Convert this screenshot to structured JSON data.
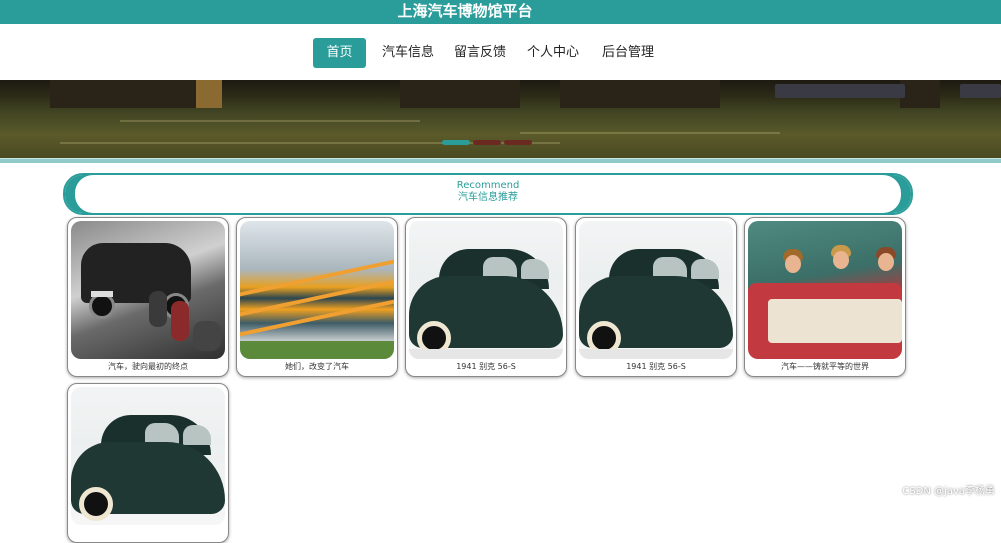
{
  "header": {
    "title": "上海汽车博物馆平台"
  },
  "nav": [
    {
      "label": "首页",
      "active": true
    },
    {
      "label": "汽车信息",
      "active": false
    },
    {
      "label": "留言反馈",
      "active": false
    },
    {
      "label": "个人中心",
      "active": false
    },
    {
      "label": "后台管理",
      "active": false
    }
  ],
  "carousel": {
    "slide_count": 3,
    "active_slide": 1
  },
  "recommend": {
    "en": "Recommend",
    "cn": "汽车信息推荐"
  },
  "cards": [
    {
      "caption": "汽车，驶向最初的终点",
      "image": "black-white-vintage-car-with-children"
    },
    {
      "caption": "她们，改变了汽车",
      "image": "modern-museum-building"
    },
    {
      "caption": "1941 别克 56-S",
      "image": "dark-green-vintage-buick"
    },
    {
      "caption": "1941 别克 56-S",
      "image": "dark-green-vintage-buick"
    },
    {
      "caption": "汽车——铸就平等的世界",
      "image": "women-in-red-convertible"
    },
    {
      "caption": "",
      "image": "dark-green-vintage-buick"
    }
  ],
  "watermark": "CSDN @java李杨勇",
  "colors": {
    "accent": "#2a9d9a",
    "nav_text": "#222222"
  }
}
